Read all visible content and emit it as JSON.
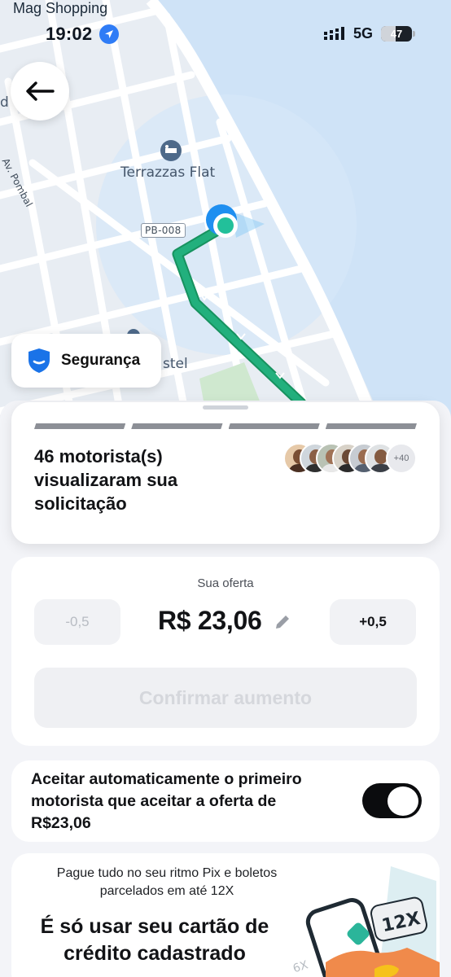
{
  "status_bar": {
    "carrier": "Mag Shopping",
    "time": "19:02",
    "network": "5G",
    "battery": "47",
    "battery_level": 0.47
  },
  "map": {
    "hotel_name": "Terrazzas Flat",
    "road_tag": "PB-008",
    "street_name": "Av. Pombal",
    "edge_letter": "d",
    "partial_place": "stel"
  },
  "security": {
    "label": "Segurança"
  },
  "drivers": {
    "count_text": "46 motorista(s) visualizaram sua solicitação",
    "more_badge": "+40",
    "progress_segments": 4
  },
  "offer": {
    "title": "Sua oferta",
    "decrease_label": "-0,5",
    "increase_label": "+0,5",
    "price": "R$ 23,06",
    "confirm_label": "Confirmar aumento"
  },
  "auto_accept": {
    "text": "Aceitar automaticamente o primeiro motorista que aceitar a oferta de R$23,06",
    "enabled": true
  },
  "promo": {
    "subtitle": "Pague tudo no seu ritmo Pix e boletos parcelados em até 12X",
    "title": "É só usar seu cartão de crédito cadastrado",
    "badge_12x": "12X",
    "badge_6x": "6X"
  },
  "colors": {
    "route": "#22b07d",
    "route_dark": "#17925f",
    "accent_blue": "#2f7cf6",
    "water": "#cfe3f7",
    "park": "#cfe8cf"
  }
}
